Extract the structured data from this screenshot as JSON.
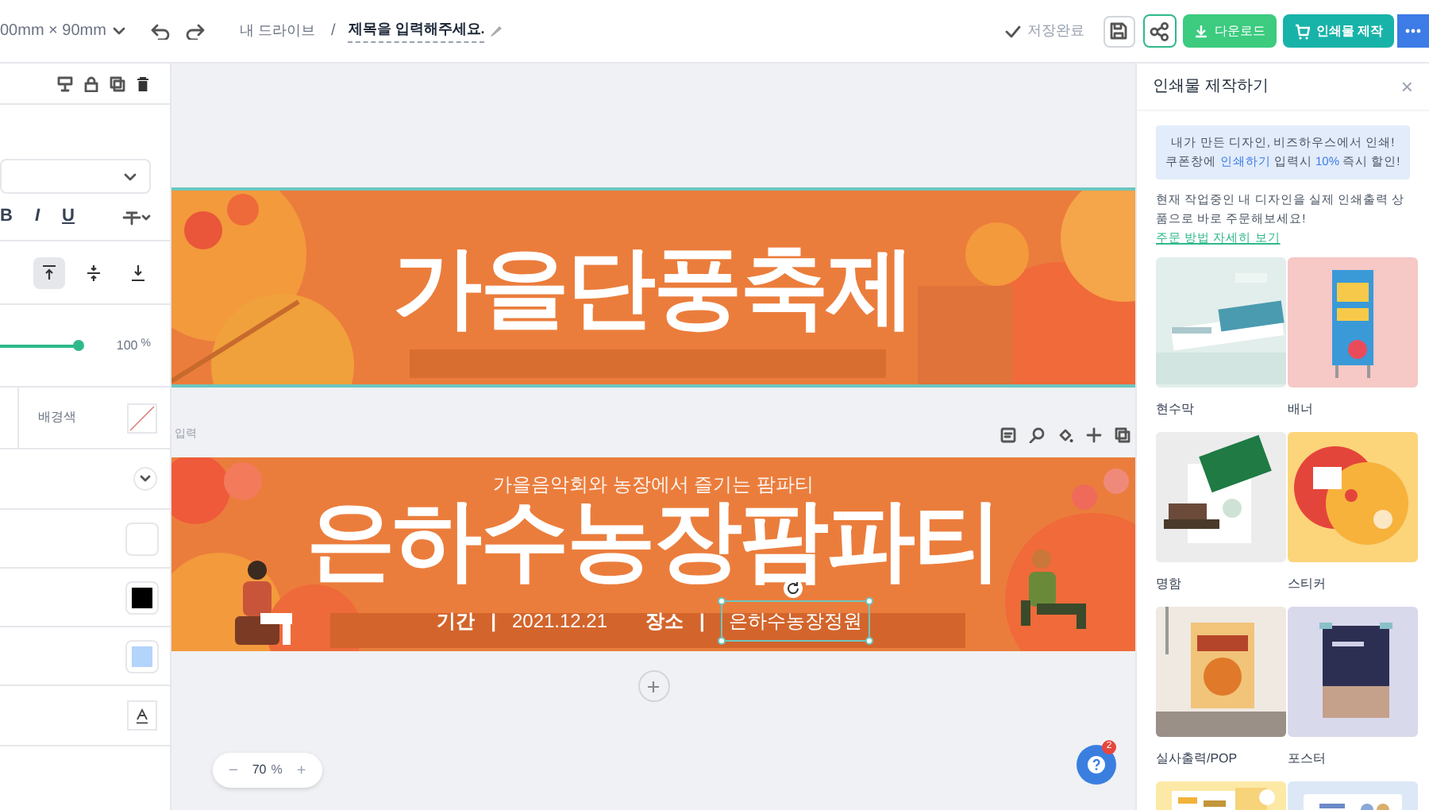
{
  "top_bar": {
    "size": "00mm × 90mm",
    "breadcrumb": "내 드라이브",
    "separator": "/",
    "title": "제목을 입력해주세요.",
    "save_status": "저장완료",
    "download": "다운로드",
    "print": "인쇄물 제작"
  },
  "left_panel": {
    "styles": [
      "B",
      "I",
      "U"
    ],
    "vertical_align": [
      {
        "selected": true
      },
      {
        "selected": false
      },
      {
        "selected": false
      }
    ],
    "opacity": {
      "level": 1,
      "reading": "100",
      "unit": "%"
    },
    "background_label": "배경색",
    "swatches": [
      {
        "color": "#ffffff"
      },
      {
        "color": "#000000"
      },
      {
        "color": "#b3d4fb"
      }
    ]
  },
  "canvas": {
    "banners": [
      {
        "title": "가을단풍축제",
        "selected": true
      },
      {
        "label": "입력",
        "subtitle": "가을음악회와 농장에서 즐기는 팜파티",
        "title": "은하수농장팜파티",
        "selected": false,
        "info": [
          {
            "kind": "label",
            "text": "기간"
          },
          {
            "kind": "divider",
            "text": "|"
          },
          {
            "kind": "value",
            "text": "2021.12.21"
          },
          {
            "kind": "label",
            "text": "장소"
          },
          {
            "kind": "divider",
            "text": "|"
          },
          {
            "kind": "selected",
            "text": "은하수농장정원"
          }
        ]
      }
    ],
    "zoom": {
      "minus": "−",
      "value": "70",
      "unit": "%",
      "plus": "+"
    },
    "help_badge": "2"
  },
  "print_panel": {
    "title": "인쇄물 제작하기",
    "close": "×",
    "notice": [
      [
        {
          "text": "내가 만든 디자인, 비즈하우스에서 인쇄!",
          "highlight": false
        }
      ],
      [
        {
          "text": "쿠폰창에 ",
          "highlight": false
        },
        {
          "text": "인쇄하기",
          "highlight": true
        },
        {
          "text": " 입력시 ",
          "highlight": false
        },
        {
          "text": "10%",
          "highlight": true
        },
        {
          "text": " 즉시 할인!",
          "highlight": false
        }
      ]
    ],
    "description": "현재 작업중인 내 디자인을 실제 인쇄출력 상품으로 바로 주문해보세요!",
    "link": "주문 방법 자세히 보기",
    "products": [
      {
        "label": "현수막",
        "color": "#e2eeeb"
      },
      {
        "label": "배너",
        "color": "#f6c8c6"
      },
      {
        "label": "명함",
        "color": "#ececec"
      },
      {
        "label": "스티커",
        "color": "#fcd47a"
      },
      {
        "label": "실사출력/POP",
        "color": "#e6e0da"
      },
      {
        "label": "포스터",
        "color": "#d9d9ec"
      },
      {
        "color": "#fde9a6"
      },
      {
        "color": "#dce8f6"
      }
    ]
  }
}
